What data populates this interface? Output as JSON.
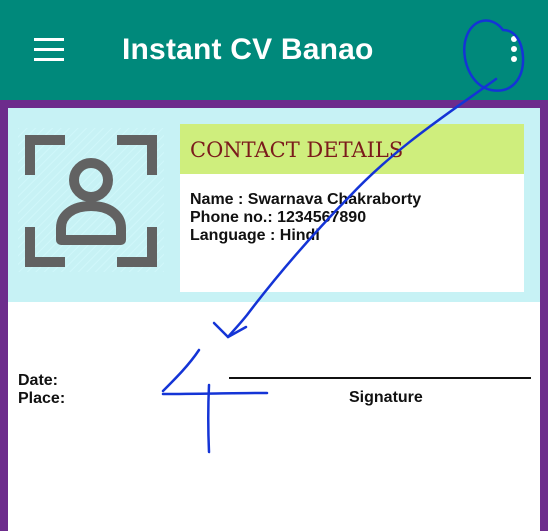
{
  "app_bar": {
    "title": "Instant CV Banao",
    "menu_icon": "hamburger-menu-icon",
    "overflow_icon": "more-vert-icon"
  },
  "profile": {
    "avatar_icon": "profile-placeholder-icon",
    "contact_title": "CONTACT DETAILS",
    "name_line": "Name : Swarnava Chakraborty",
    "phone_line": "Phone no.: 1234567890",
    "language_line": "Language : Hindi"
  },
  "footer": {
    "date_label": "Date:",
    "place_label": "Place:",
    "signature_label": "Signature"
  },
  "colors": {
    "appbar": "#00897b",
    "frame": "#6d2c8c",
    "panel": "#c7f2f5",
    "contact_header": "#cfee7d",
    "contact_title": "#7b1b1b",
    "annotation": "#1434d6"
  }
}
